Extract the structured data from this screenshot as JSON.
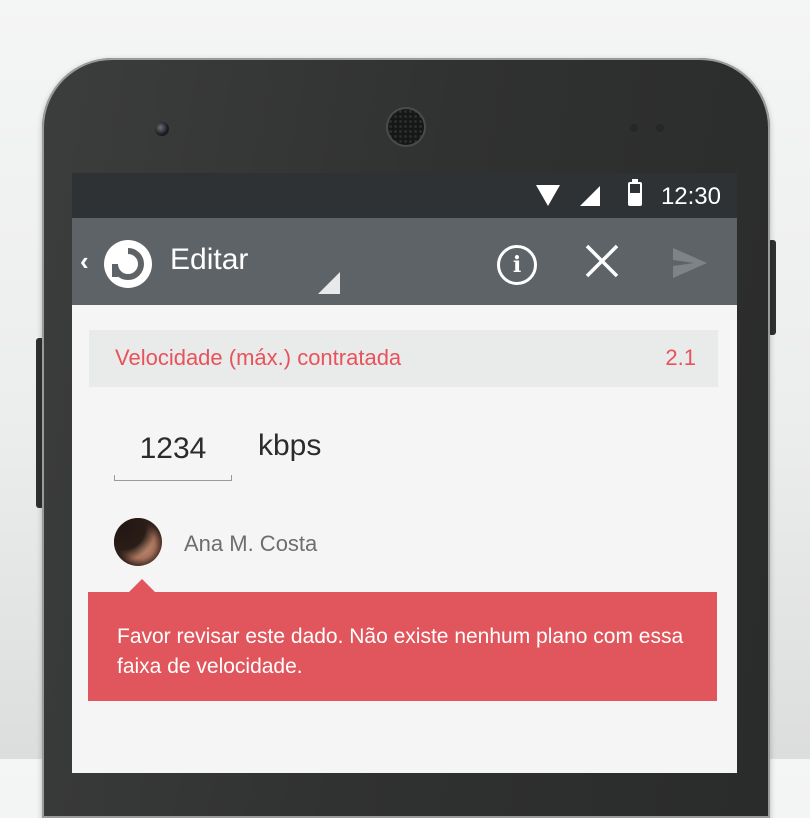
{
  "status_bar": {
    "time": "12:30"
  },
  "app_bar": {
    "title": "Editar"
  },
  "field": {
    "label": "Velocidade (máx.) contratada",
    "code": "2.1",
    "value": "1234",
    "unit": "kbps"
  },
  "user": {
    "name": "Ana M. Costa"
  },
  "error": {
    "message": "Favor revisar este dado. Não existe nenhum plano com essa faixa de velocidade."
  },
  "colors": {
    "accent": "#e8525a",
    "error_bg": "#e1565c",
    "app_bar": "#5d6367",
    "status_bar": "#2e3235"
  },
  "icons": [
    "wifi-icon",
    "signal-icon",
    "battery-icon",
    "back-icon",
    "app-logo-icon",
    "info-icon",
    "close-icon",
    "send-icon"
  ]
}
